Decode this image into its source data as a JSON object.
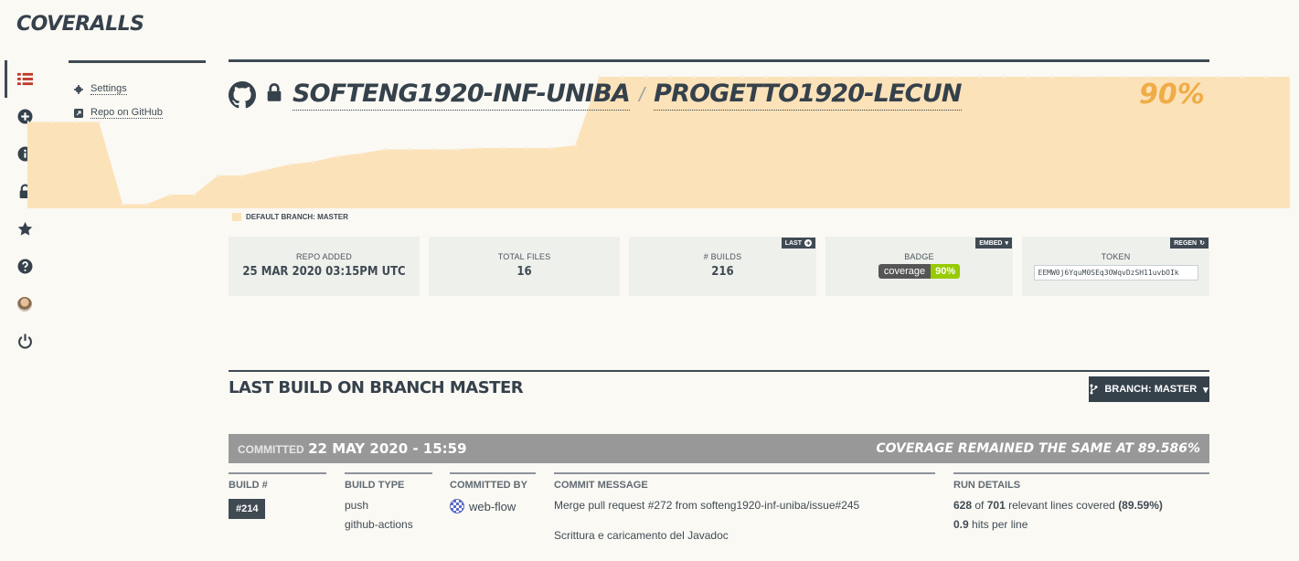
{
  "app": {
    "logo": "COVERALLS"
  },
  "rail": [
    "list-icon",
    "plus-circle-icon",
    "info-icon",
    "lock-icon",
    "star-icon",
    "question-icon",
    "avatar",
    "power-icon"
  ],
  "side_menu": {
    "settings": "Settings",
    "repo_github": "Repo on GitHub"
  },
  "repo": {
    "owner": "SOFTENG1920-INF-UNIBA",
    "separator": "/",
    "name": "PROGETTO1920-LECUN",
    "coverage": "90%"
  },
  "chart_data": {
    "type": "area",
    "series": [
      {
        "name": "DEFAULT BRANCH: MASTER",
        "values": [
          63,
          63,
          63,
          63,
          3,
          3,
          10,
          10,
          24,
          24,
          28,
          32,
          34,
          38,
          40,
          43,
          43,
          43,
          43,
          44,
          44,
          44,
          44,
          46,
          96,
          96,
          96,
          96,
          96,
          96,
          96,
          96,
          96,
          96,
          96,
          96,
          96,
          96,
          96,
          96,
          96,
          96,
          96,
          96,
          96,
          96,
          96,
          96,
          96,
          96,
          96,
          96,
          96,
          96
        ]
      }
    ],
    "ylim": [
      0,
      100
    ],
    "color": "#fce2b9"
  },
  "legend": {
    "label": "DEFAULT BRANCH: MASTER"
  },
  "cards": {
    "repo_added": {
      "label": "REPO ADDED",
      "value": "25 MAR 2020 03:15PM UTC"
    },
    "total_files": {
      "label": "TOTAL FILES",
      "value": "16"
    },
    "builds": {
      "label": "# BUILDS",
      "value": "216",
      "button": "LAST"
    },
    "badge": {
      "label": "BADGE",
      "button": "EMBED",
      "left": "coverage",
      "right": "90%"
    },
    "token": {
      "label": "TOKEN",
      "button": "REGEN",
      "value": "EEMW0j6YquM0SEq3OWqvDzSH11uvbOIk"
    }
  },
  "last_build": {
    "title": "LAST BUILD ON BRANCH MASTER",
    "branch_button": "BRANCH: MASTER",
    "committed_label": "COMMITTED",
    "committed_date": "22 MAY 2020 - 15:59",
    "coverage_note": "COVERAGE REMAINED THE SAME AT 89.586%",
    "build_header": "BUILD #",
    "build_number": "#214",
    "build_type_header": "BUILD TYPE",
    "build_type_1": "push",
    "build_type_2": "github-actions",
    "committed_by_header": "COMMITTED BY",
    "committed_by": "web-flow",
    "commit_message_header": "COMMIT MESSAGE",
    "commit_message_1": "Merge pull request #272 from softeng1920-inf-uniba/issue#245",
    "commit_message_2": "Scrittura e caricamento del Javadoc",
    "run_details_header": "RUN DETAILS",
    "lines_covered": "628",
    "of_label": "of",
    "lines_total": "701",
    "lines_text": "relevant lines covered",
    "lines_pct": "(89.59%)",
    "hits": "0.9",
    "hits_text": "hits per line"
  }
}
